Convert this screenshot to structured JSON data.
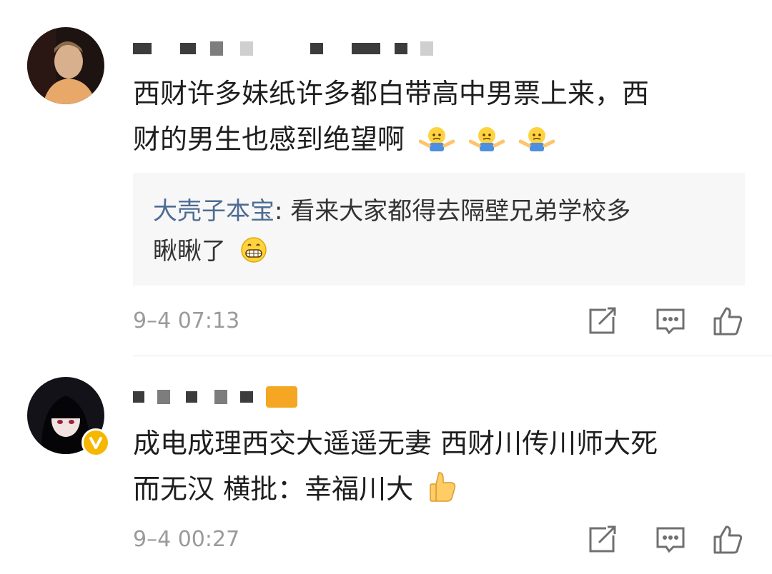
{
  "comments": [
    {
      "text_line1": "西财许多妹纸许多都白带高中男票上来，西",
      "text_line2": "财的男生也感到绝望啊",
      "emojis": [
        "shrug-emoji",
        "shrug-emoji",
        "shrug-emoji"
      ],
      "reply": {
        "author": "大壳子本宝",
        "separator": ": ",
        "text_line1": "看来大家都得去隔壁兄弟学校多",
        "text_line2": "瞅瞅了",
        "emoji": "grin-emoji"
      },
      "time": "9–4 07:13",
      "actions": [
        "share-icon",
        "comment-icon",
        "like-icon"
      ]
    },
    {
      "text_line1": "成电成理西交大遥遥无妻 西财川传川师大死",
      "text_line2": "而无汉 横批：幸福川大",
      "emoji": "thumbs-up-emoji",
      "badge": "V",
      "time": "9–4 00:27",
      "actions": [
        "share-icon",
        "comment-icon",
        "like-icon"
      ]
    }
  ],
  "colors": {
    "reply_author": "#4e6c93",
    "reply_background": "#f7f7f7",
    "timestamp": "#9a9a9a",
    "verified_badge": "#f6b700"
  }
}
